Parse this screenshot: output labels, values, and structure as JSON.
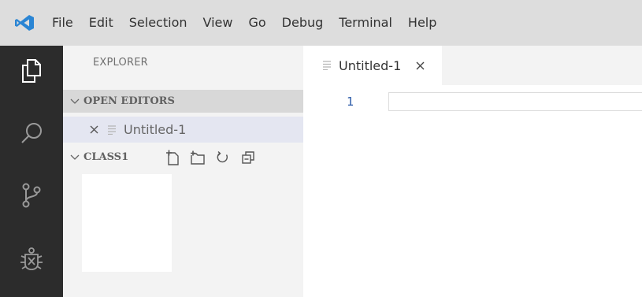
{
  "menu": {
    "items": [
      "File",
      "Edit",
      "Selection",
      "View",
      "Go",
      "Debug",
      "Terminal",
      "Help"
    ]
  },
  "activity_bar": {
    "icons": [
      "explorer-icon",
      "search-icon",
      "source-control-icon",
      "debug-icon"
    ]
  },
  "sidebar": {
    "title": "EXPLORER",
    "open_editors": {
      "label": "OPEN EDITORS",
      "items": [
        "Untitled-1"
      ]
    },
    "folder": {
      "label": "CLASS1",
      "actions": [
        "new-file-icon",
        "new-folder-icon",
        "refresh-icon",
        "collapse-all-icon"
      ]
    }
  },
  "editor": {
    "tab": {
      "label": "Untitled-1"
    },
    "line_number": "1"
  },
  "colors": {
    "brand": "#2a85d4",
    "activity_bar": "#2c2c2c",
    "menubar": "#dddddd",
    "line_number": "#2b5aa8"
  }
}
